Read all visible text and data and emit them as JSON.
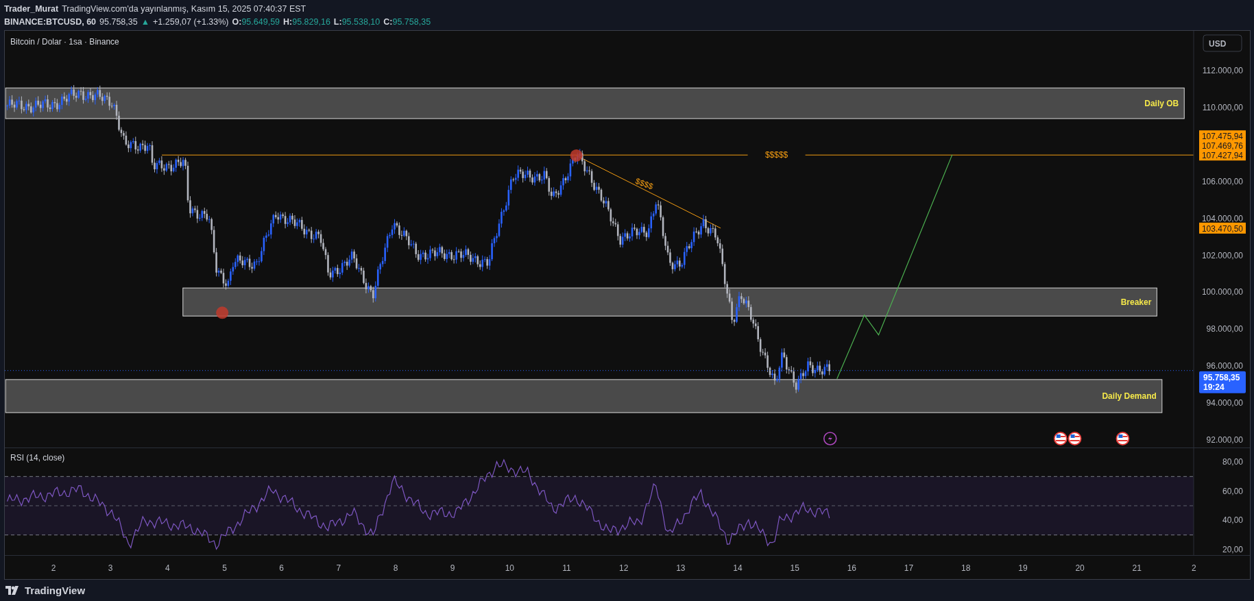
{
  "header": {
    "author": "Trader_Murat",
    "published": "TradingView.com'da yayınlanmış, Kasım 15, 2025 07:40:37 EST",
    "symbol": "BINANCE:BTCUSD, 60",
    "last": "95.758,35",
    "change_arrow": "▲",
    "change": "+1.259,07 (+1.33%)",
    "ohlc": [
      {
        "label": "O:",
        "value": "95.649,59"
      },
      {
        "label": "H:",
        "value": "95.829,16"
      },
      {
        "label": "L:",
        "value": "95.538,10"
      },
      {
        "label": "C:",
        "value": "95.758,35"
      }
    ]
  },
  "chart": {
    "title": "Bitcoin / Dolar · 1sa · Binance",
    "currency": "USD",
    "zones": [
      {
        "label": "Daily OB"
      },
      {
        "label": "Breaker"
      },
      {
        "label": "Daily Demand"
      }
    ],
    "level_label": "$$$$$",
    "trend_label": "$$$$",
    "price_axis": [
      "112.000,00",
      "110.000,00",
      "106.000,00",
      "104.000,00",
      "102.000,00",
      "100.000,00",
      "98.000,00",
      "96.000,00",
      "94.000,00",
      "92.000,00"
    ],
    "price_tags": [
      {
        "labels": [
          "107.475,94",
          "107.469,76",
          "107.427,94"
        ]
      },
      {
        "labels": [
          "103.470,50"
        ]
      }
    ],
    "current_price": {
      "value": "95.758,35",
      "countdown": "19:24"
    }
  },
  "rsi": {
    "title": "RSI (14, close)",
    "axis": [
      "80,00",
      "60,00",
      "40,00",
      "20,00"
    ]
  },
  "time_axis": [
    "2",
    "3",
    "4",
    "5",
    "6",
    "7",
    "8",
    "9",
    "10",
    "11",
    "12",
    "13",
    "14",
    "15",
    "16",
    "17",
    "18",
    "19",
    "20",
    "21",
    "2"
  ],
  "footer": {
    "brand": "TradingView"
  }
}
